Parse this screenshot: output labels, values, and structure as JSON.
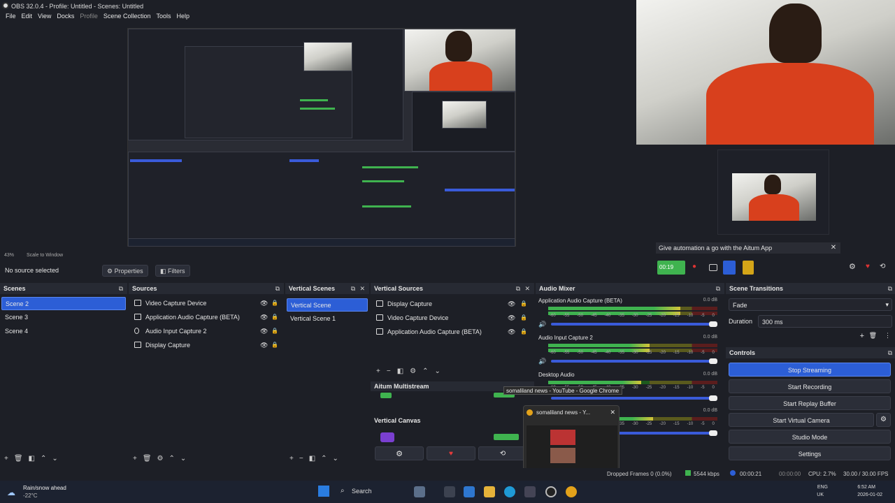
{
  "window": {
    "title": "OBS 32.0.4 - Profile: Untitled - Scenes: Untitled"
  },
  "menu": [
    "File",
    "Edit",
    "View",
    "Docks",
    "Profile",
    "Scene Collection",
    "Tools",
    "Help"
  ],
  "preview": {
    "zoom": "43%",
    "scale_mode": "Scale to Window"
  },
  "source_bar": {
    "no_source": "No source selected",
    "properties": "Properties",
    "filters": "Filters"
  },
  "aitum_banner": "Give automation a go with the Aitum App",
  "mini_timer": "00:19",
  "docks": {
    "scenes": {
      "title": "Scenes",
      "items": [
        "Scene 2",
        "Scene 3",
        "Scene 4"
      ],
      "selected": 0
    },
    "sources": {
      "title": "Sources",
      "items": [
        {
          "label": "Video Capture Device",
          "icon": "camera-icon"
        },
        {
          "label": "Application Audio Capture (BETA)",
          "icon": "app-audio-icon"
        },
        {
          "label": "Audio Input Capture 2",
          "icon": "microphone-icon"
        },
        {
          "label": "Display Capture",
          "icon": "monitor-icon"
        }
      ]
    },
    "vertical_scenes": {
      "title": "Vertical Scenes",
      "items": [
        "Vertical Scene",
        "Vertical Scene 1"
      ],
      "selected": 0
    },
    "vertical_sources": {
      "title": "Vertical Sources",
      "items": [
        {
          "label": "Display Capture",
          "icon": "monitor-icon"
        },
        {
          "label": "Video Capture Device",
          "icon": "camera-icon"
        },
        {
          "label": "Application Audio Capture (BETA)",
          "icon": "app-audio-icon"
        }
      ],
      "aitum_multistream": "Aitum Multistream",
      "vertical_canvas": "Vertical Canvas"
    },
    "audio_mixer": {
      "title": "Audio Mixer",
      "channels": [
        {
          "name": "Application Audio Capture (BETA)",
          "db": "0.0 dB",
          "level": 0.78
        },
        {
          "name": "Audio Input Capture 2",
          "db": "0.0 dB",
          "level": 0.6
        },
        {
          "name": "Desktop Audio",
          "db": "0.0 dB",
          "level": 0.55
        },
        {
          "name": "",
          "db": "0.0 dB",
          "level": 0.62
        }
      ],
      "ticks": [
        "-60",
        "-55",
        "-50",
        "-45",
        "-40",
        "-35",
        "-30",
        "-25",
        "-20",
        "-15",
        "-10",
        "-5",
        "0"
      ]
    },
    "scene_transitions": {
      "title": "Scene Transitions",
      "transition": "Fade",
      "duration_label": "Duration",
      "duration_value": "300 ms"
    },
    "controls": {
      "title": "Controls",
      "buttons": [
        "Stop Streaming",
        "Start Recording",
        "Start Replay Buffer",
        "Start Virtual Camera",
        "Studio Mode",
        "Settings"
      ]
    }
  },
  "popup": {
    "tooltip": "somaliland news - YouTube - Google Chrome",
    "title": "somaliland news - Y..."
  },
  "status_bar": {
    "dropped_frames": "Dropped Frames 0 (0.0%)",
    "bitrate": "5544 kbps",
    "stream_time": "00:00:21",
    "record_time": "00:00:00",
    "cpu": "CPU: 2.7%",
    "fps": "30.00 / 30.00 FPS"
  },
  "taskbar": {
    "weather_title": "Rain/snow ahead",
    "weather_temp": "-22°C",
    "search": "Search",
    "lang_1": "ENG",
    "lang_2": "UK",
    "time": "6:52 AM",
    "date": "2026-01-02"
  },
  "colors": {
    "accent": "#2c5ed6",
    "meter_green": "#3fb34f",
    "background": "#1d1f26"
  }
}
